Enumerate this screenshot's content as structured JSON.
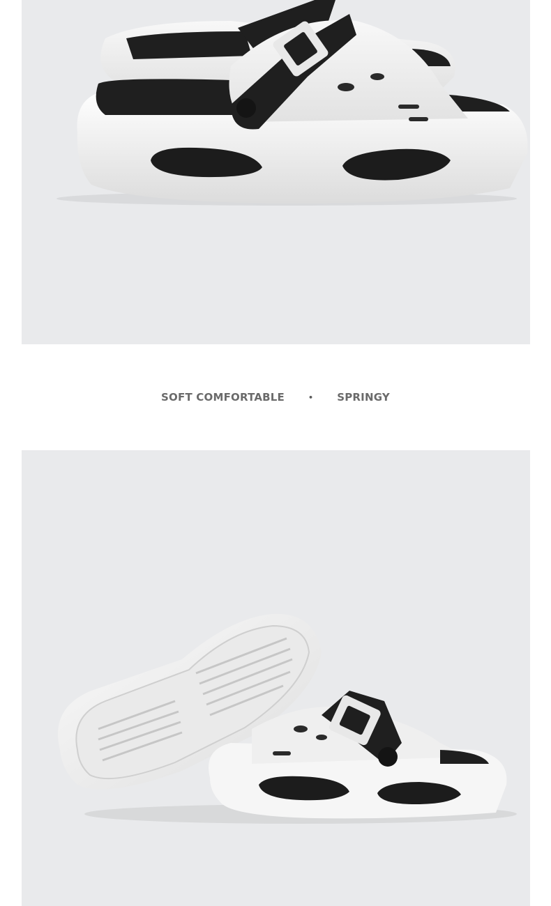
{
  "images": {
    "top": {
      "subject": "white slide sandal with black buckle strap, side view",
      "background": "#e9eaec"
    },
    "bottom": {
      "subject": "pair of white slide sandals, one showing tread sole",
      "background": "#e9eaec"
    }
  },
  "features": {
    "left": "SOFT COMFORTABLE",
    "separator": "•",
    "right": "SPRINGY"
  },
  "colors": {
    "text": "#6a6a6a",
    "panel": "#e9eaec",
    "shoe_white": "#f4f4f4",
    "shoe_black": "#1f1f1f"
  }
}
